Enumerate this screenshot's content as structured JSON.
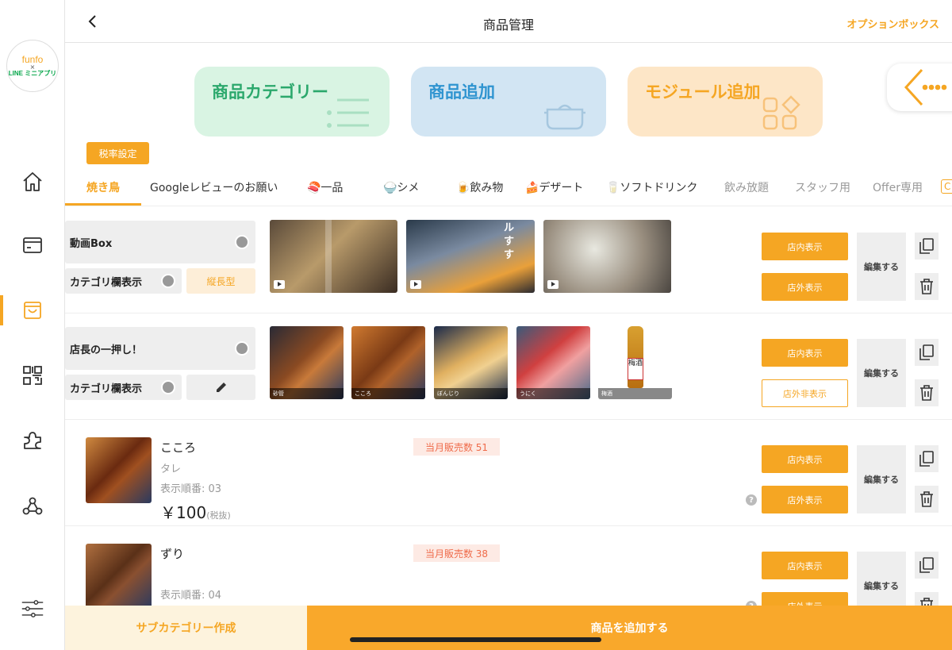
{
  "sidebar": {
    "logo": {
      "line1": "funfo",
      "line2": "×",
      "line3": "LINE ミニアプリ"
    },
    "nav": [
      {
        "icon": "home-icon"
      },
      {
        "icon": "card-icon"
      },
      {
        "icon": "bag-icon",
        "active": true
      },
      {
        "icon": "qr-icon"
      },
      {
        "icon": "puzzle-icon"
      },
      {
        "icon": "network-icon"
      },
      {
        "icon": "sliders-icon"
      }
    ]
  },
  "header": {
    "title": "商品管理",
    "option_box": "オプションボックス"
  },
  "cards": [
    {
      "label": "商品カテゴリー",
      "color": "#2ba86c"
    },
    {
      "label": "商品追加",
      "color": "#2f94d0"
    },
    {
      "label": "モジュール追加",
      "color": "#f5a623"
    }
  ],
  "tax_button": "税率設定",
  "tabs": [
    {
      "label": "焼き鳥",
      "state": "active"
    },
    {
      "label": "Googleレビューのお願い",
      "state": "normal"
    },
    {
      "label": "🍣一品",
      "state": "normal"
    },
    {
      "label": "🍚シメ",
      "state": "normal"
    },
    {
      "label": "🍺飲み物",
      "state": "normal"
    },
    {
      "label": "🍰デザート",
      "state": "normal"
    },
    {
      "label": "🥛ソフトドリンク",
      "state": "normal"
    },
    {
      "label": "飲み放題",
      "state": "inactive"
    },
    {
      "label": "スタッフ用",
      "state": "inactive"
    },
    {
      "label": "Offer専用",
      "state": "inactive"
    },
    {
      "label": "C",
      "state": "cut"
    }
  ],
  "modules": [
    {
      "title": "動画Box",
      "category_display": "カテゴリ欄表示",
      "style_tag": "縦長型",
      "thumbnails": [
        {
          "video": true,
          "caption": ""
        },
        {
          "video": true,
          "caption": "",
          "overlay_text": [
            "ル",
            "す",
            "す"
          ]
        },
        {
          "video": true,
          "caption": ""
        }
      ],
      "btn_in_store": "店内表示",
      "btn_out_store": "店外表示",
      "edit": "編集する"
    },
    {
      "title": "店長の一押し！",
      "category_display": "カテゴリ欄表示",
      "thumbnails": [
        {
          "caption": "砂管"
        },
        {
          "caption": "こころ"
        },
        {
          "caption": "ぼんじり"
        },
        {
          "caption": "うにく"
        },
        {
          "caption": "梅酒",
          "label_text": "梅酒"
        }
      ],
      "btn_in_store": "店内表示",
      "btn_out_store": "店外非表示",
      "edit": "編集する"
    }
  ],
  "products": [
    {
      "name": "こころ",
      "sauce": "タレ",
      "order": "表示順番: 03",
      "price": "￥100",
      "tax_note": "(税抜)",
      "sales": "当月販売数 51",
      "btn_in_store": "店内表示",
      "btn_out_store": "店外表示",
      "edit": "編集する",
      "help": "?"
    },
    {
      "name": "ずり",
      "order": "表示順番: 04",
      "sales": "当月販売数 38",
      "btn_in_store": "店内表示",
      "btn_out_store": "店外表示",
      "edit": "編集する",
      "help": "?"
    }
  ],
  "bottom": {
    "subcategory": "サブカテゴリー作成",
    "add_product": "商品を追加する"
  },
  "colors": {
    "accent": "#f5a623",
    "green": "#2ba86c",
    "blue": "#2f94d0",
    "sales_text": "#ef6b4a"
  }
}
